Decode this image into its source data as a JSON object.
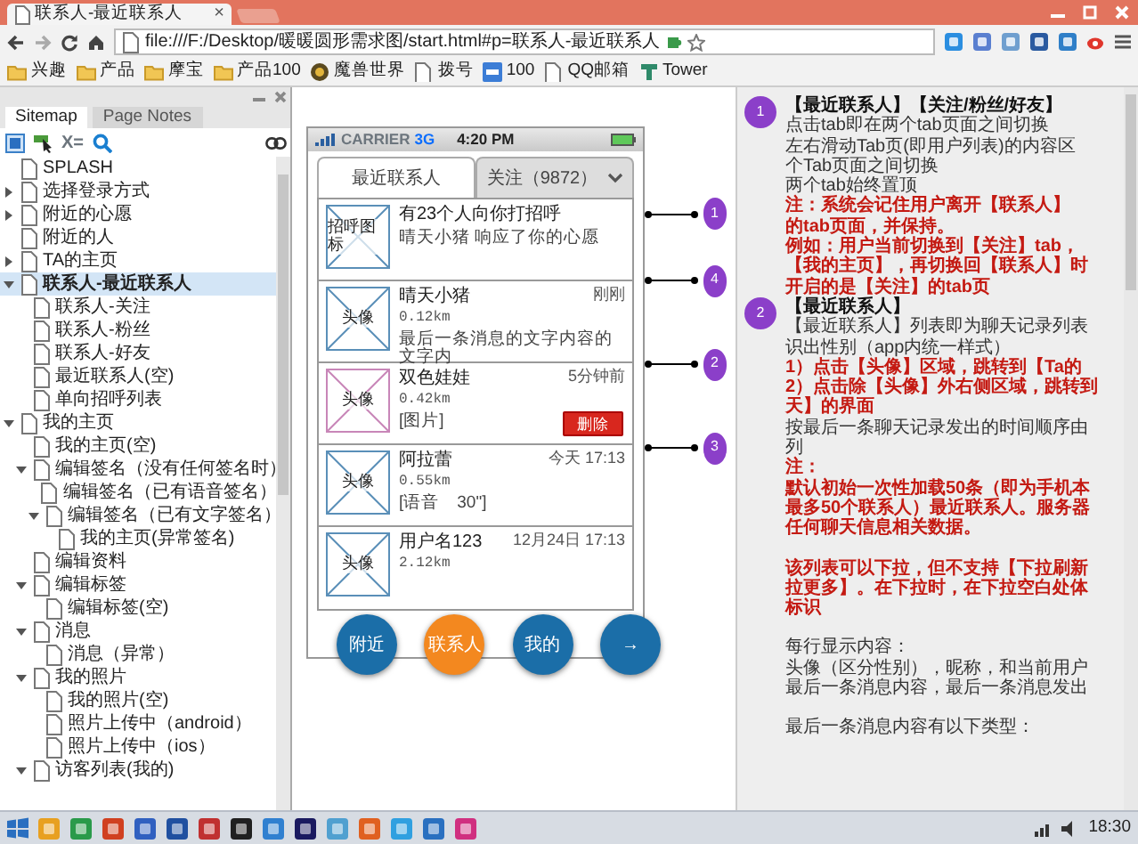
{
  "browser": {
    "tab_title": "联系人-最近联系人",
    "tab_close": "×",
    "url": "file:///F:/Desktop/暖暖圆形需求图/start.html#p=联系人-最近联系人",
    "bookmarks": [
      {
        "label": "兴趣",
        "kind": "folder"
      },
      {
        "label": "产品",
        "kind": "folder"
      },
      {
        "label": "摩宝",
        "kind": "folder"
      },
      {
        "label": "产品100",
        "kind": "folder"
      },
      {
        "label": "魔兽世界",
        "kind": "game"
      },
      {
        "label": "拨号",
        "kind": "page"
      },
      {
        "label": "100",
        "kind": "app"
      },
      {
        "label": "QQ邮箱",
        "kind": "page"
      },
      {
        "label": "Tower",
        "kind": "tower"
      }
    ]
  },
  "sidebar": {
    "tabs": [
      {
        "label": "Sitemap",
        "selected": true
      },
      {
        "label": "Page Notes",
        "selected": false
      }
    ],
    "toolbar_text": "X=",
    "tree": [
      {
        "label": "SPLASH",
        "selected": false
      },
      {
        "label": "选择登录方式",
        "expanded": false,
        "selected": false
      },
      {
        "label": "附近的心愿",
        "expanded": false,
        "selected": false
      },
      {
        "label": "附近的人",
        "selected": false
      },
      {
        "label": "TA的主页",
        "expanded": false,
        "selected": false
      },
      {
        "label": "联系人-最近联系人",
        "expanded": true,
        "selected": true,
        "children": [
          {
            "label": "联系人-关注",
            "selected": false
          },
          {
            "label": "联系人-粉丝",
            "selected": false
          },
          {
            "label": "联系人-好友",
            "selected": false
          },
          {
            "label": "最近联系人(空)",
            "selected": false
          },
          {
            "label": "单向招呼列表",
            "selected": false
          }
        ]
      },
      {
        "label": "我的主页",
        "expanded": true,
        "selected": false,
        "children": [
          {
            "label": "我的主页(空)",
            "selected": false
          },
          {
            "label": "编辑签名（没有任何签名时）",
            "expanded": true,
            "selected": false,
            "children": [
              {
                "label": "编辑签名（已有语音签名）",
                "selected": false
              },
              {
                "label": "编辑签名（已有文字签名）",
                "expanded": true,
                "selected": false,
                "children": [
                  {
                    "label": "我的主页(异常签名)",
                    "selected": false
                  }
                ]
              }
            ]
          },
          {
            "label": "编辑资料",
            "selected": false
          },
          {
            "label": "编辑标签",
            "expanded": true,
            "selected": false,
            "children": [
              {
                "label": "编辑标签(空)",
                "selected": false
              }
            ]
          },
          {
            "label": "消息",
            "expanded": true,
            "selected": false,
            "children": [
              {
                "label": "消息（异常）",
                "selected": false
              }
            ]
          },
          {
            "label": "我的照片",
            "expanded": true,
            "selected": false,
            "children": [
              {
                "label": "我的照片(空)",
                "selected": false
              },
              {
                "label": "照片上传中（android）",
                "selected": false
              },
              {
                "label": "照片上传中（ios）",
                "selected": false
              }
            ]
          },
          {
            "label": "访客列表(我的)",
            "expanded": true,
            "selected": false
          }
        ]
      }
    ]
  },
  "phone": {
    "status": {
      "carrier": "CARRIER",
      "network": "3G",
      "time": "4:20 PM"
    },
    "tabs": [
      {
        "label": "最近联系人",
        "selected": true
      },
      {
        "label": "关注（9872）",
        "selected": false
      }
    ],
    "tabs_callout": "1",
    "rows": [
      {
        "avatar": "招呼图标",
        "color": "#5a8fb8",
        "name": "有23个人向你打招呼",
        "message": "晴天小猪 响应了你的心愿",
        "callout": "4"
      },
      {
        "avatar": "头像",
        "color": "#5a8fb8",
        "name": "晴天小猪",
        "distance": "0.12km",
        "message": "最后一条消息的文字内容的文字内",
        "time": "刚刚",
        "callout": "2"
      },
      {
        "avatar": "头像",
        "color": "#c886b8",
        "name": "双色娃娃",
        "distance": "0.42km",
        "message": "[图片]",
        "time": "5分钟前",
        "delete_button": "删除",
        "callout": "3"
      },
      {
        "avatar": "头像",
        "color": "#5a8fb8",
        "name": "阿拉蕾",
        "distance": "0.55km",
        "message": "[语音　30\"]",
        "time": "今天 17:13"
      },
      {
        "avatar": "头像",
        "color": "#5a8fb8",
        "name": "用户名123",
        "distance": "2.12km",
        "time": "12月24日 17:13"
      }
    ],
    "nav": [
      {
        "label": "附近",
        "selected": false
      },
      {
        "label": "联系人",
        "selected": true
      },
      {
        "label": "我的",
        "selected": false
      },
      {
        "label": "→",
        "selected": false
      }
    ]
  },
  "notes": [
    {
      "number": "1",
      "lines": [
        {
          "text": "【最近联系人】【关注/粉丝/好友】",
          "kind": "heading"
        },
        {
          "text": "点击tab即在两个tab页面之间切换",
          "kind": "normal"
        },
        {
          "text": "左右滑动Tab页(即用户列表)的内容区",
          "kind": "normal"
        },
        {
          "text": "个Tab页面之间切换",
          "kind": "normal"
        },
        {
          "text": "两个tab始终置顶",
          "kind": "normal"
        },
        {
          "text": "注：系统会记住用户离开【联系人】",
          "kind": "red"
        },
        {
          "text": "的tab页面，并保持。",
          "kind": "red"
        },
        {
          "text": "例如：用户当前切换到【关注】tab，",
          "kind": "red"
        },
        {
          "text": "【我的主页】，再切换回【联系人】时",
          "kind": "red"
        },
        {
          "text": "开启的是【关注】的tab页",
          "kind": "red"
        }
      ]
    },
    {
      "number": "2",
      "lines": [
        {
          "text": "【最近联系人】",
          "kind": "heading"
        },
        {
          "text": "【最近联系人】列表即为聊天记录列表",
          "kind": "normal"
        },
        {
          "text": "识出性别（app内统一样式）",
          "kind": "normal"
        },
        {
          "text": "1）点击【头像】区域，跳转到【Ta的",
          "kind": "red"
        },
        {
          "text": "2）点击除【头像】外右侧区域，跳转到",
          "kind": "red"
        },
        {
          "text": "天】的界面",
          "kind": "red"
        },
        {
          "text": "按最后一条聊天记录发出的时间顺序由",
          "kind": "normal"
        },
        {
          "text": "列",
          "kind": "normal"
        },
        {
          "text": "注：",
          "kind": "red"
        },
        {
          "text": "默认初始一次性加载50条（即为手机本",
          "kind": "red"
        },
        {
          "text": "最多50个联系人）最近联系人。服务器",
          "kind": "red"
        },
        {
          "text": "任何聊天信息相关数据。",
          "kind": "red"
        },
        {
          "text": "该列表可以下拉，但不支持【下拉刷新",
          "kind": "red",
          "space_before": true
        },
        {
          "text": "拉更多】。在下拉时，在下拉空白处体",
          "kind": "red"
        },
        {
          "text": "标识",
          "kind": "red"
        },
        {
          "text": "每行显示内容：",
          "kind": "normal",
          "space_before": true
        },
        {
          "text": "头像（区分性别），昵称，和当前用户",
          "kind": "normal"
        },
        {
          "text": "最后一条消息内容，最后一条消息发出",
          "kind": "normal"
        },
        {
          "text": "最后一条消息内容有以下类型：",
          "kind": "normal",
          "space_before": true
        }
      ]
    }
  ],
  "taskbar": {
    "clock": "18:30"
  }
}
